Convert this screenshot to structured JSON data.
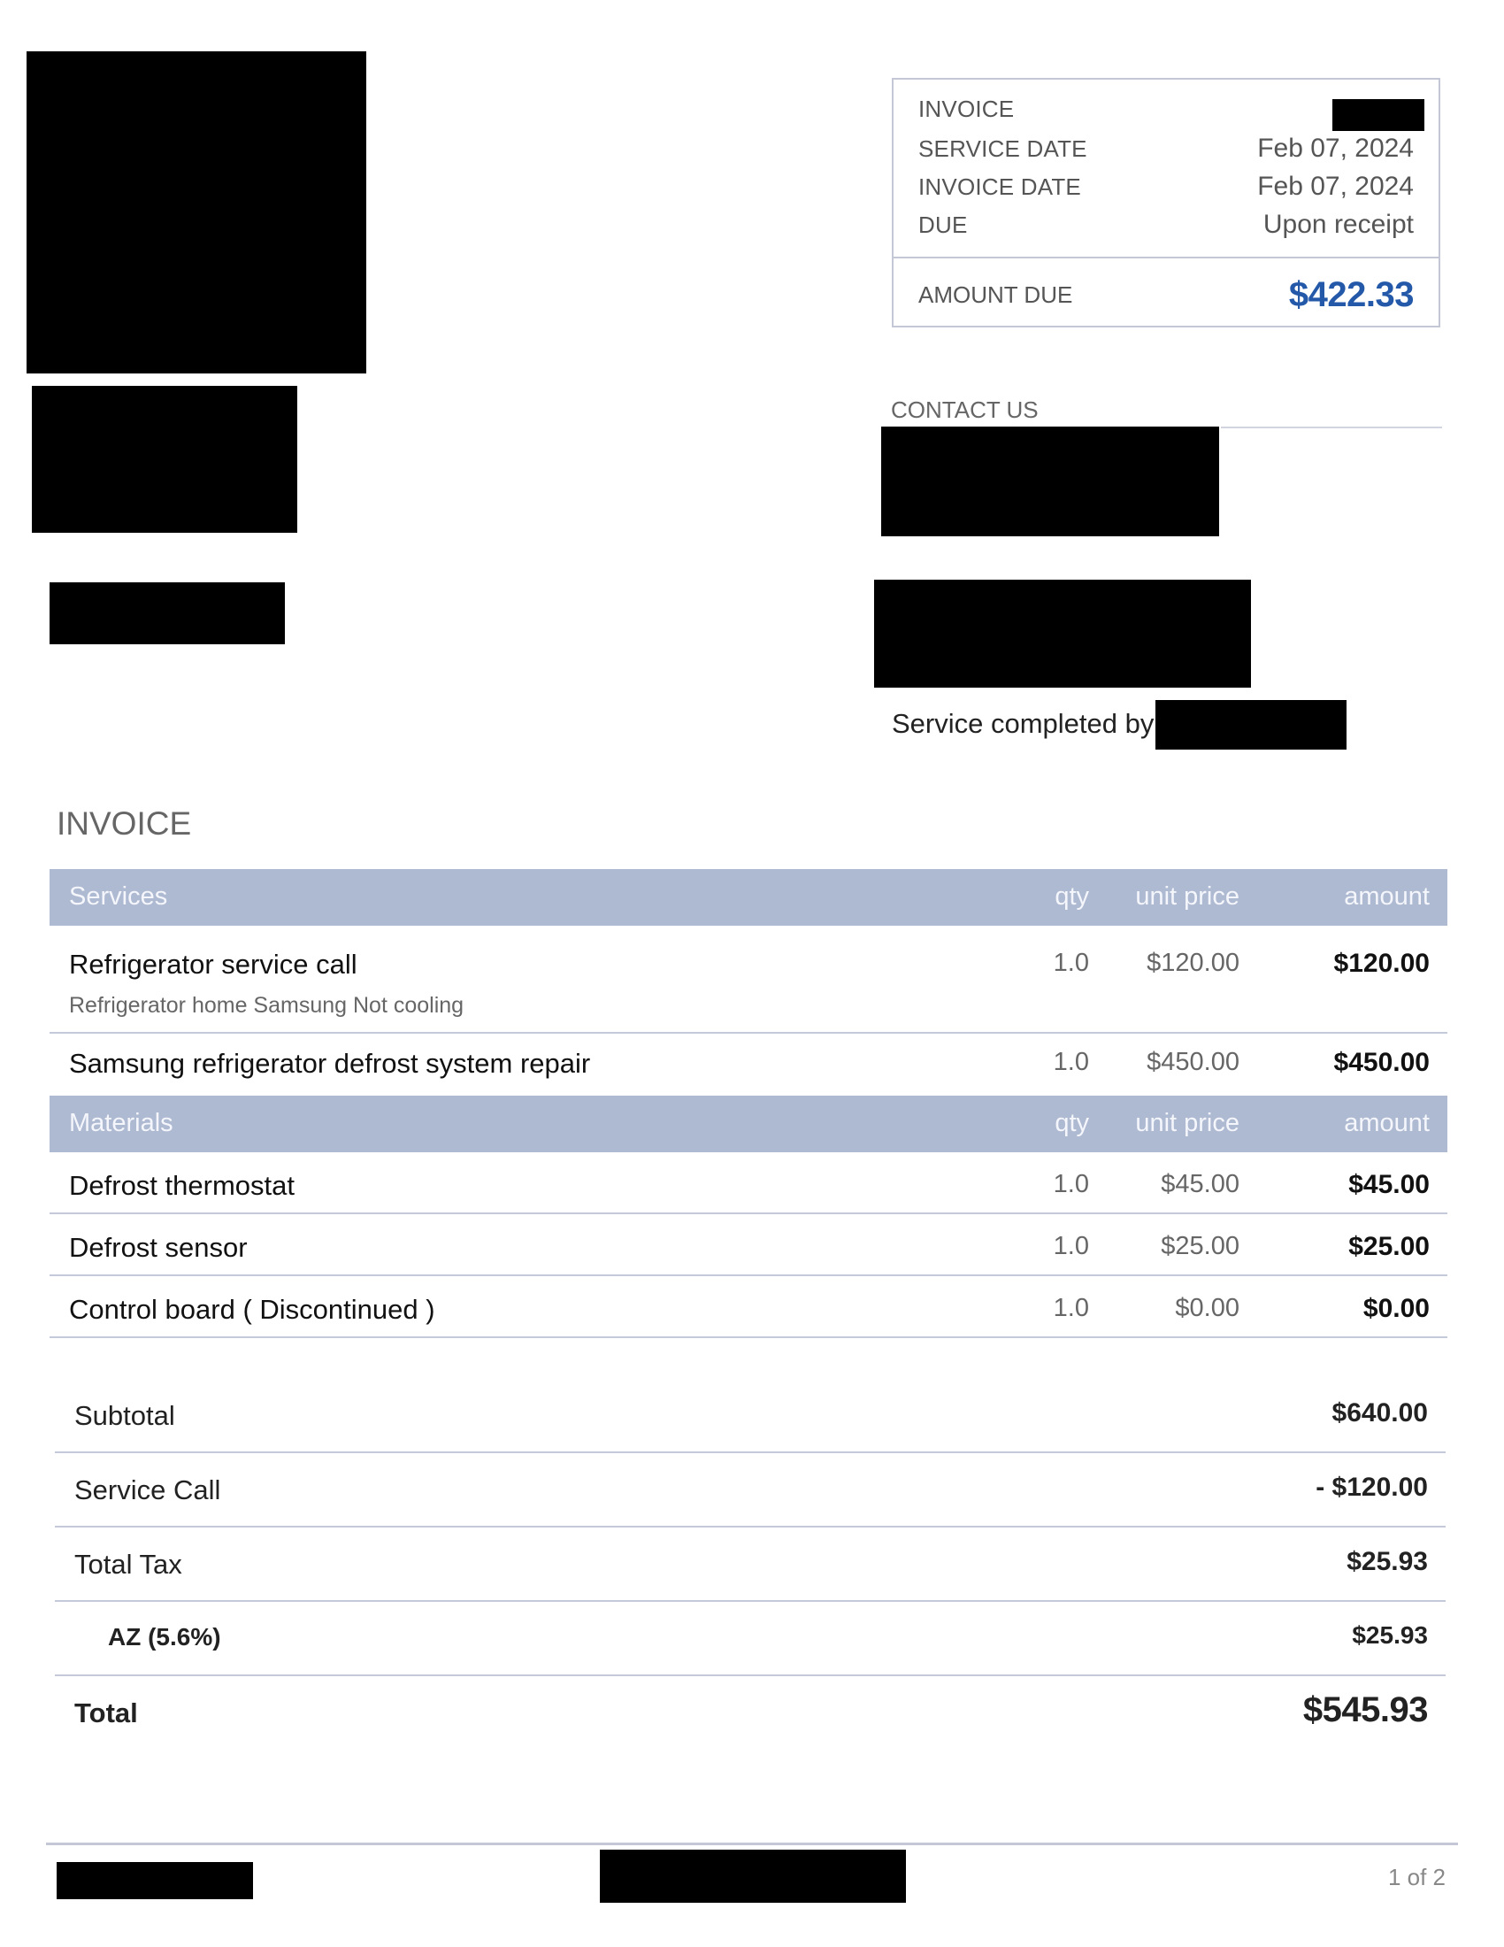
{
  "info_box": {
    "rows": [
      {
        "label": "INVOICE",
        "value": null,
        "redacted": true
      },
      {
        "label": "SERVICE DATE",
        "value": "Feb 07, 2024"
      },
      {
        "label": "INVOICE DATE",
        "value": "Feb 07, 2024"
      },
      {
        "label": "DUE",
        "value": "Upon receipt"
      }
    ],
    "amount_due_label": "AMOUNT DUE",
    "amount_due_value": "$422.33",
    "accent_color": "#2359a8"
  },
  "contact": {
    "title": "CONTACT US"
  },
  "service_completed_by": "Service completed by:",
  "invoice_heading": "INVOICE",
  "sections": [
    {
      "name": "Services",
      "columns": {
        "qty": "qty",
        "unit_price": "unit price",
        "amount": "amount"
      },
      "items": [
        {
          "description": "Refrigerator service call",
          "subtext": "Refrigerator home Samsung Not cooling",
          "qty": "1.0",
          "unit_price": "$120.00",
          "amount": "$120.00"
        },
        {
          "description": "Samsung refrigerator defrost system repair",
          "subtext": null,
          "qty": "1.0",
          "unit_price": "$450.00",
          "amount": "$450.00"
        }
      ]
    },
    {
      "name": "Materials",
      "columns": {
        "qty": "qty",
        "unit_price": "unit price",
        "amount": "amount"
      },
      "items": [
        {
          "description": "Defrost thermostat",
          "qty": "1.0",
          "unit_price": "$45.00",
          "amount": "$45.00"
        },
        {
          "description": "Defrost sensor",
          "qty": "1.0",
          "unit_price": "$25.00",
          "amount": "$25.00"
        },
        {
          "description": "Control board ( Discontinued )",
          "qty": "1.0",
          "unit_price": "$0.00",
          "amount": "$0.00"
        }
      ]
    }
  ],
  "totals": [
    {
      "label": "Subtotal",
      "value": "$640.00"
    },
    {
      "label": "Service Call",
      "value": "- $120.00"
    },
    {
      "label": "Total Tax",
      "value": "$25.93"
    },
    {
      "label": "AZ (5.6%)",
      "value": "$25.93"
    },
    {
      "label": "Total",
      "value": "$545.93"
    }
  ],
  "footer": {
    "page": "1 of 2"
  },
  "colors": {
    "table_header_bg": "#aeb9d2",
    "divider": "#c5cadb"
  }
}
